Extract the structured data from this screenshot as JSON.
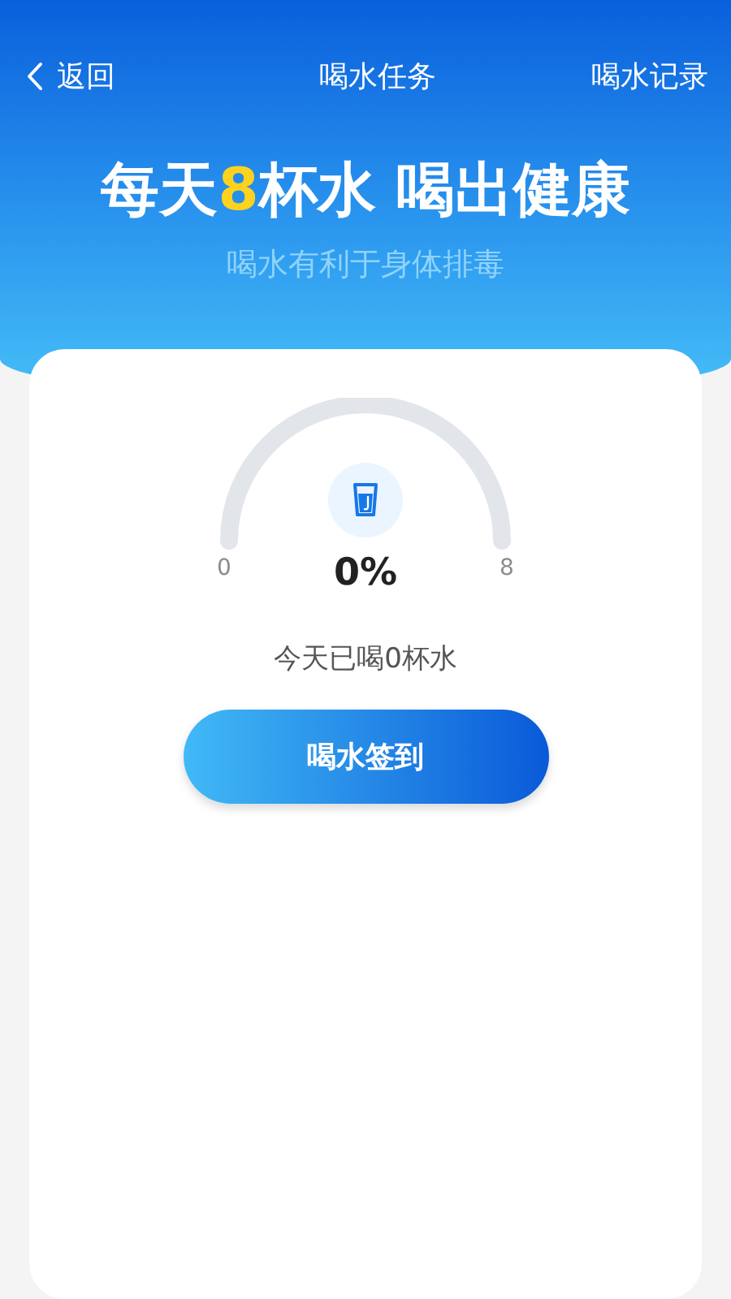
{
  "nav": {
    "back": "返回",
    "title": "喝水任务",
    "action": "喝水记录"
  },
  "headline": [
    {
      "text": "每天",
      "highlight": false
    },
    {
      "text": "8",
      "highlight": true
    },
    {
      "text": "杯水 喝出健康",
      "highlight": false
    }
  ],
  "subtitle": "喝水有利于身体排毒",
  "gauge": {
    "min": "0",
    "max": "8",
    "percent": "0%"
  },
  "today": "今天已喝0杯水",
  "button": "喝水签到"
}
